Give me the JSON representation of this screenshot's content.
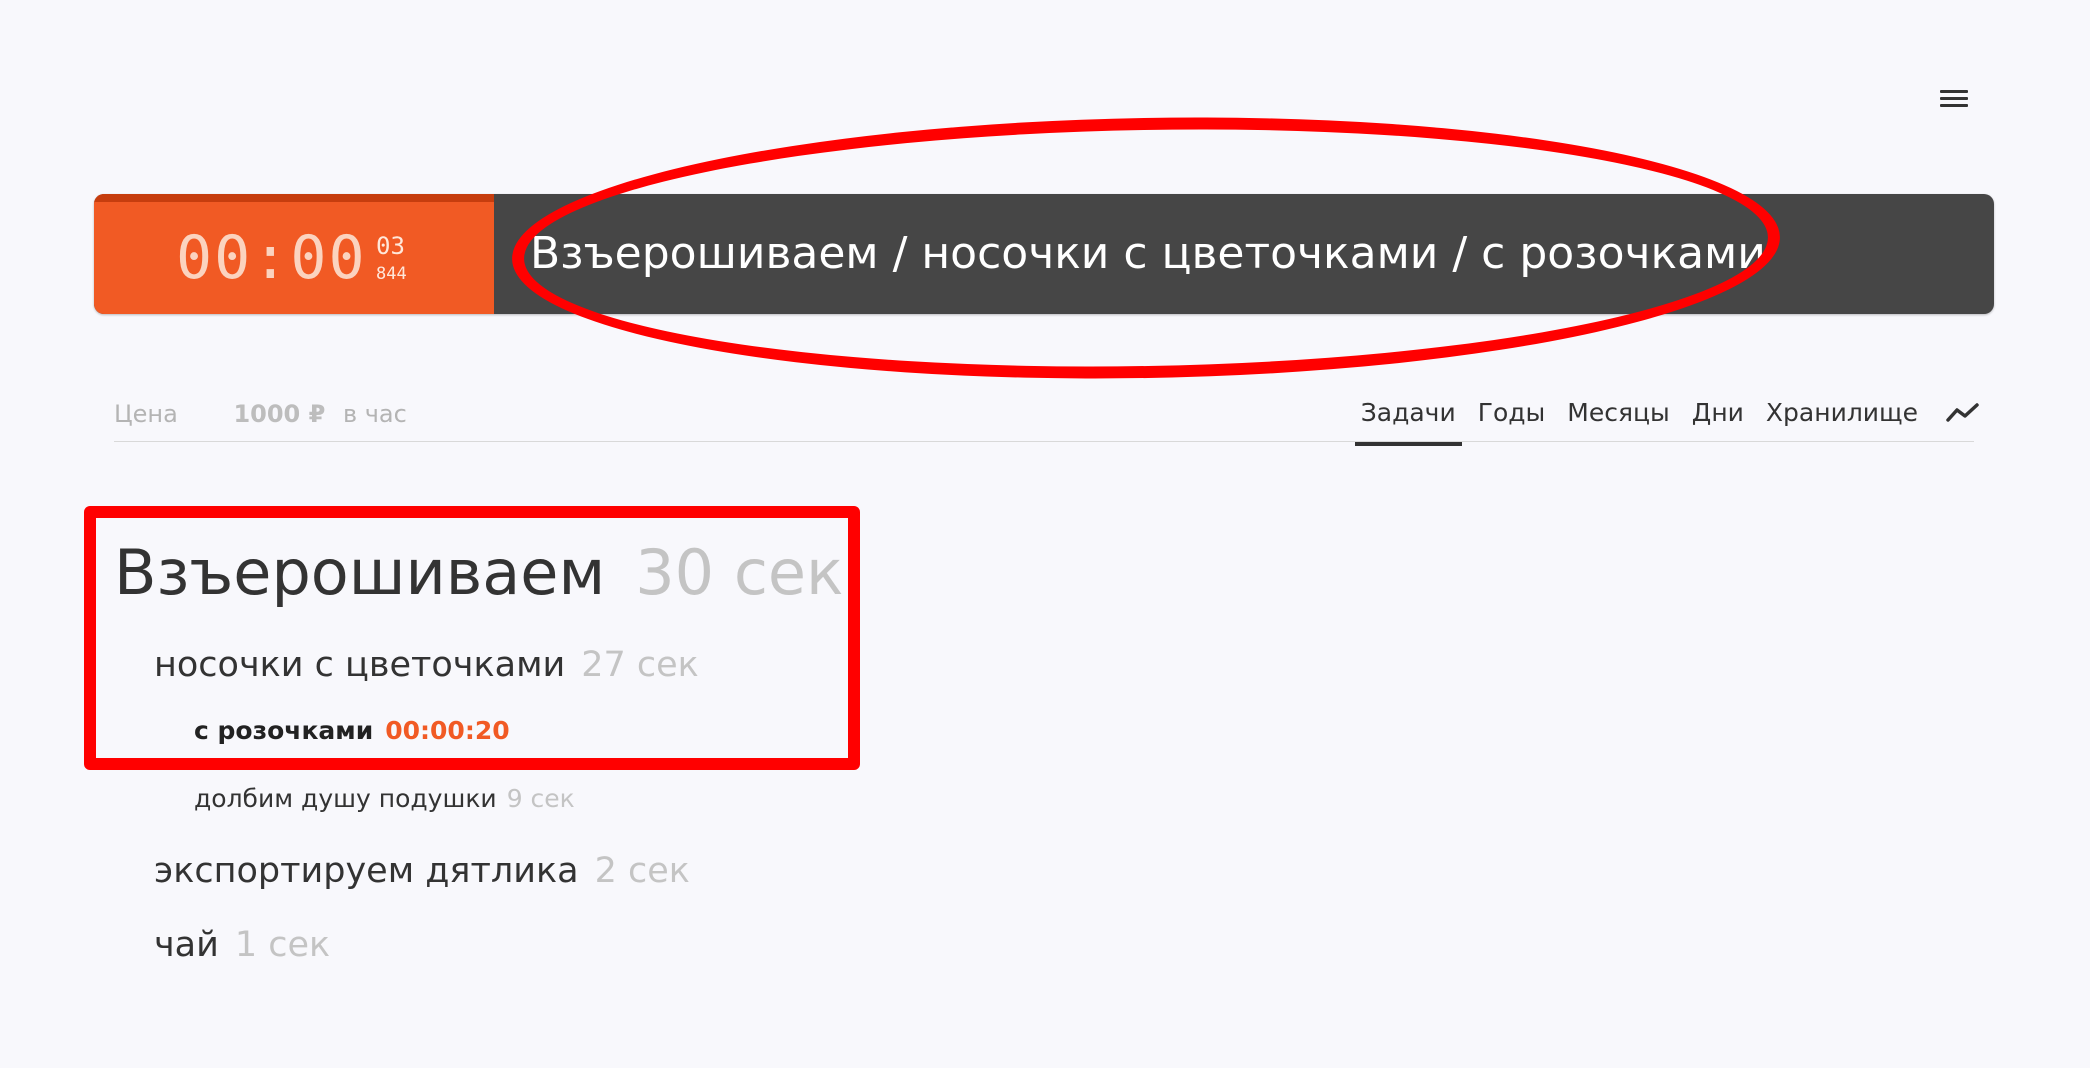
{
  "header": {
    "menu_icon": "hamburger-menu-icon"
  },
  "timer": {
    "main": "00:00",
    "seconds": "03",
    "milliseconds": "844",
    "task_path": "Взъерошиваем / носочки с цветочками / с розочками"
  },
  "price": {
    "label": "Цена",
    "value": "1000 ₽",
    "unit": "в час"
  },
  "tabs": [
    {
      "label": "Задачи",
      "active": true
    },
    {
      "label": "Годы",
      "active": false
    },
    {
      "label": "Месяцы",
      "active": false
    },
    {
      "label": "Дни",
      "active": false
    },
    {
      "label": "Хранилище",
      "active": false
    }
  ],
  "stats_icon": "trend-chart-icon",
  "tasks": {
    "root": {
      "name": "Взъерошиваем",
      "time": "30 сек"
    },
    "child1": {
      "name": "носочки с цветочками",
      "time": "27 сек"
    },
    "child1_sub1": {
      "name": "с розочками",
      "time": "00:00:20",
      "active": true
    },
    "child1_sub2": {
      "name": "долбим душу подушки",
      "time": "9 сек"
    },
    "child2": {
      "name": "экспортируем дятлика",
      "time": "2 сек"
    },
    "child3": {
      "name": "чай",
      "time": "1 сек"
    }
  },
  "colors": {
    "accent": "#f15a24",
    "timer_bar_bg": "#464646",
    "annotation": "#ff0000",
    "page_bg": "#f8f8fc"
  }
}
